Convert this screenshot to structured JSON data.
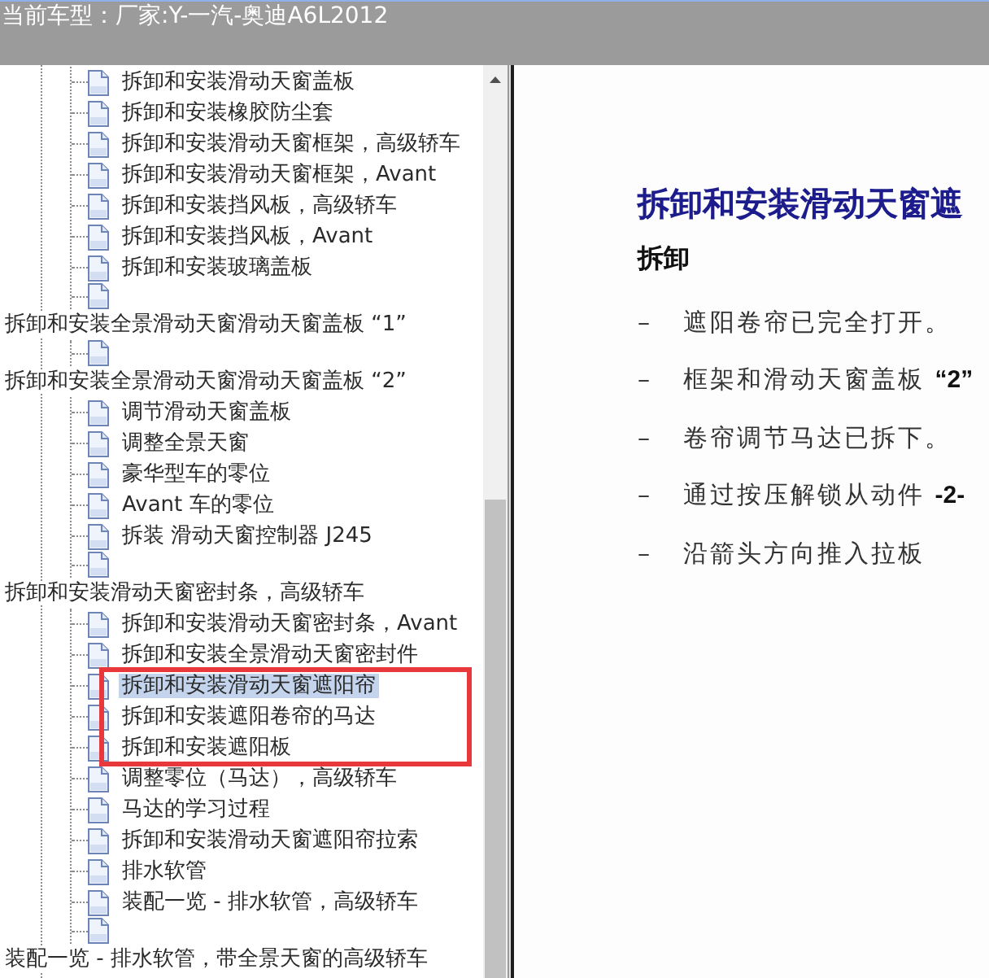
{
  "header": {
    "label": "当前车型：",
    "value": "厂家:Y-一汽-奥迪A6L2012"
  },
  "tree": [
    {
      "kind": "topic",
      "children": [
        {
          "kind": "page",
          "label": "拆卸和安装滑动天窗盖板",
          "selected": false
        },
        {
          "kind": "page",
          "label": "拆卸和安装橡胶防尘套",
          "selected": false
        },
        {
          "kind": "page",
          "label": "拆卸和安装滑动天窗框架，高级轿车",
          "selected": false
        },
        {
          "kind": "page",
          "label": "拆卸和安装滑动天窗框架，Avant",
          "selected": false
        },
        {
          "kind": "page",
          "label": "拆卸和安装挡风板，高级轿车",
          "selected": false
        },
        {
          "kind": "page",
          "label": "拆卸和安装挡风板，Avant",
          "selected": false
        },
        {
          "kind": "page",
          "label": "拆卸和安装玻璃盖板",
          "selected": false
        },
        {
          "kind": "page",
          "selected": false
        }
      ]
    },
    {
      "kind": "topic",
      "label": "拆卸和安装全景滑动天窗滑动天窗盖板 “1”",
      "selected": false,
      "children": [
        {
          "kind": "page",
          "selected": false
        }
      ]
    },
    {
      "kind": "topic",
      "label": "拆卸和安装全景滑动天窗滑动天窗盖板 “2”",
      "selected": false,
      "children": [
        {
          "kind": "page",
          "label": "调节滑动天窗盖板",
          "selected": false
        },
        {
          "kind": "page",
          "label": "调整全景天窗",
          "selected": false
        },
        {
          "kind": "page",
          "label": "豪华型车的零位",
          "selected": false
        },
        {
          "kind": "page",
          "label": "Avant 车的零位",
          "selected": false
        },
        {
          "kind": "page",
          "label": "拆装 滑动天窗控制器 J245",
          "selected": false
        },
        {
          "kind": "page",
          "selected": false
        }
      ]
    },
    {
      "kind": "topic",
      "label": "拆卸和安装滑动天窗密封条，高级轿车",
      "selected": false,
      "children": [
        {
          "kind": "page",
          "label": "拆卸和安装滑动天窗密封条，Avant",
          "selected": false
        },
        {
          "kind": "page",
          "label": "拆卸和安装全景滑动天窗密封件",
          "selected": false
        },
        {
          "kind": "page",
          "label": "拆卸和安装滑动天窗遮阳帘",
          "selected": true
        },
        {
          "kind": "page",
          "label": "拆卸和安装遮阳卷帘的马达",
          "selected": false
        },
        {
          "kind": "page",
          "label": "拆卸和安装遮阳板",
          "selected": false
        },
        {
          "kind": "page",
          "label": "调整零位（马达），高级轿车",
          "selected": false
        },
        {
          "kind": "page",
          "label": "马达的学习过程",
          "selected": false
        },
        {
          "kind": "page",
          "label": "拆卸和安装滑动天窗遮阳帘拉索",
          "selected": false
        },
        {
          "kind": "page",
          "label": "排水软管",
          "selected": false
        },
        {
          "kind": "page",
          "label": "装配一览 - 排水软管，高级轿车",
          "selected": false
        },
        {
          "kind": "page",
          "selected": false
        }
      ]
    },
    {
      "kind": "topic",
      "label": "装配一览 - 排水软管，带全景天窗的高级轿车",
      "selected": false
    }
  ],
  "document": {
    "title": "拆卸和安装滑动天窗遮",
    "section": "拆卸",
    "steps": [
      {
        "marker": "–",
        "text": "遮阳卷帘已完全打开。"
      },
      {
        "marker": "–",
        "text": "框架和滑动天窗盖板 **“2”**"
      },
      {
        "marker": "–",
        "text": "卷帘调节马达已拆下。"
      },
      {
        "marker": "–",
        "text": "通过按压解锁从动件 **-2-**"
      },
      {
        "marker": "–",
        "text": "沿箭头方向推入拉板"
      }
    ]
  }
}
